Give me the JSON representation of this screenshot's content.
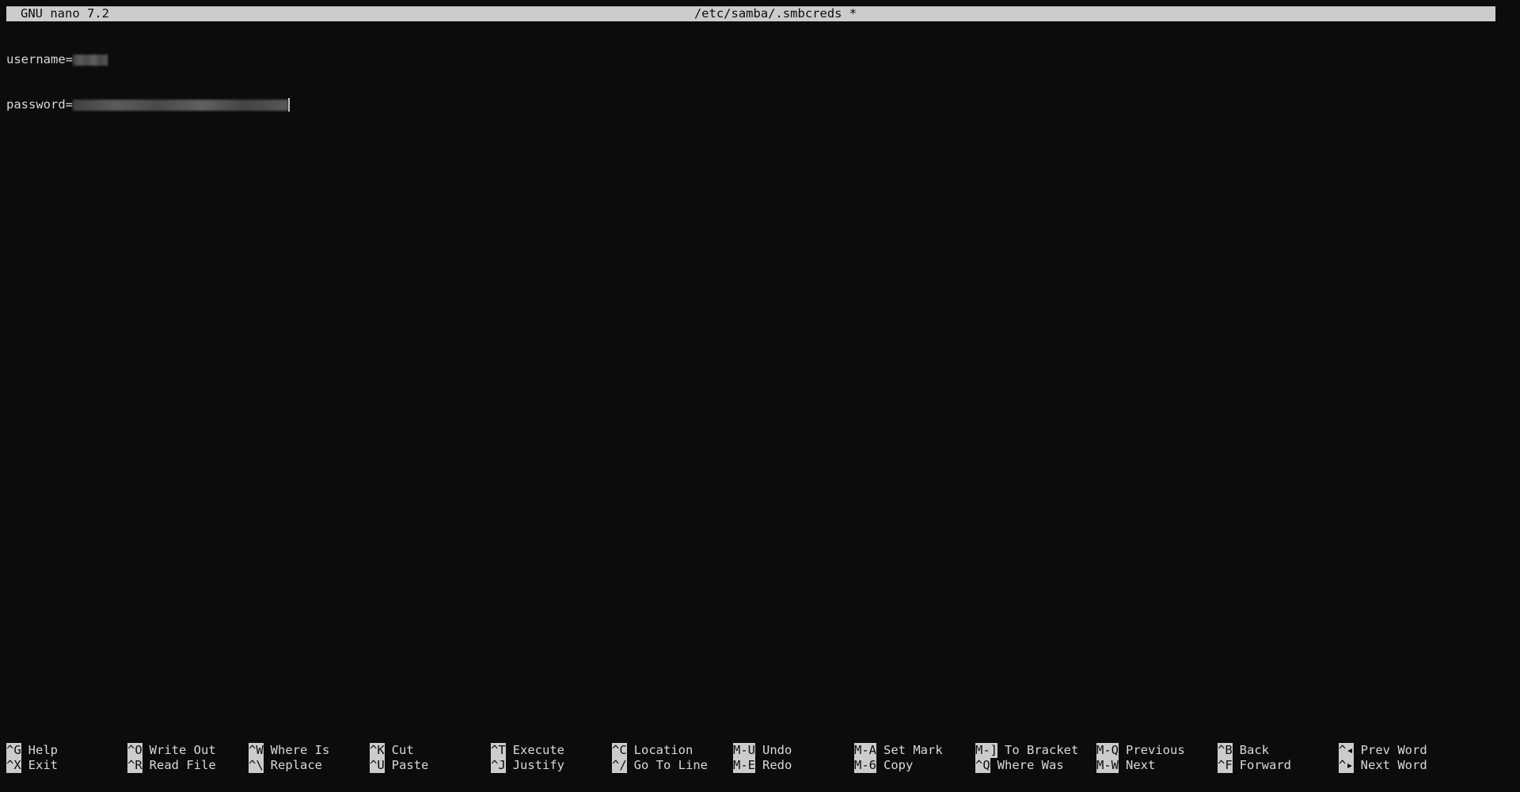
{
  "titlebar": {
    "app": "GNU nano 7.2",
    "file": "/etc/samba/.smbcreds *"
  },
  "editor": {
    "lines": [
      {
        "key": "username=",
        "value_hidden": true
      },
      {
        "key": "password=",
        "value_hidden": true
      }
    ]
  },
  "shortcuts": {
    "row1": [
      {
        "key": "^G",
        "label": "Help"
      },
      {
        "key": "^O",
        "label": "Write Out"
      },
      {
        "key": "^W",
        "label": "Where Is"
      },
      {
        "key": "^K",
        "label": "Cut"
      },
      {
        "key": "^T",
        "label": "Execute"
      },
      {
        "key": "^C",
        "label": "Location"
      },
      {
        "key": "M-U",
        "label": "Undo"
      },
      {
        "key": "M-A",
        "label": "Set Mark"
      },
      {
        "key": "M-]",
        "label": "To Bracket"
      },
      {
        "key": "M-Q",
        "label": "Previous"
      },
      {
        "key": "^B",
        "label": "Back"
      },
      {
        "key": "^◂",
        "label": "Prev Word"
      }
    ],
    "row2": [
      {
        "key": "^X",
        "label": "Exit"
      },
      {
        "key": "^R",
        "label": "Read File"
      },
      {
        "key": "^\\",
        "label": "Replace"
      },
      {
        "key": "^U",
        "label": "Paste"
      },
      {
        "key": "^J",
        "label": "Justify"
      },
      {
        "key": "^/",
        "label": "Go To Line"
      },
      {
        "key": "M-E",
        "label": "Redo"
      },
      {
        "key": "M-6",
        "label": "Copy"
      },
      {
        "key": "^Q",
        "label": "Where Was"
      },
      {
        "key": "M-W",
        "label": "Next"
      },
      {
        "key": "^F",
        "label": "Forward"
      },
      {
        "key": "^▸",
        "label": "Next Word"
      }
    ]
  },
  "colors": {
    "background": "#0c0c0c",
    "foreground": "#d9d9d9",
    "inverse_bg": "#cccccc"
  }
}
